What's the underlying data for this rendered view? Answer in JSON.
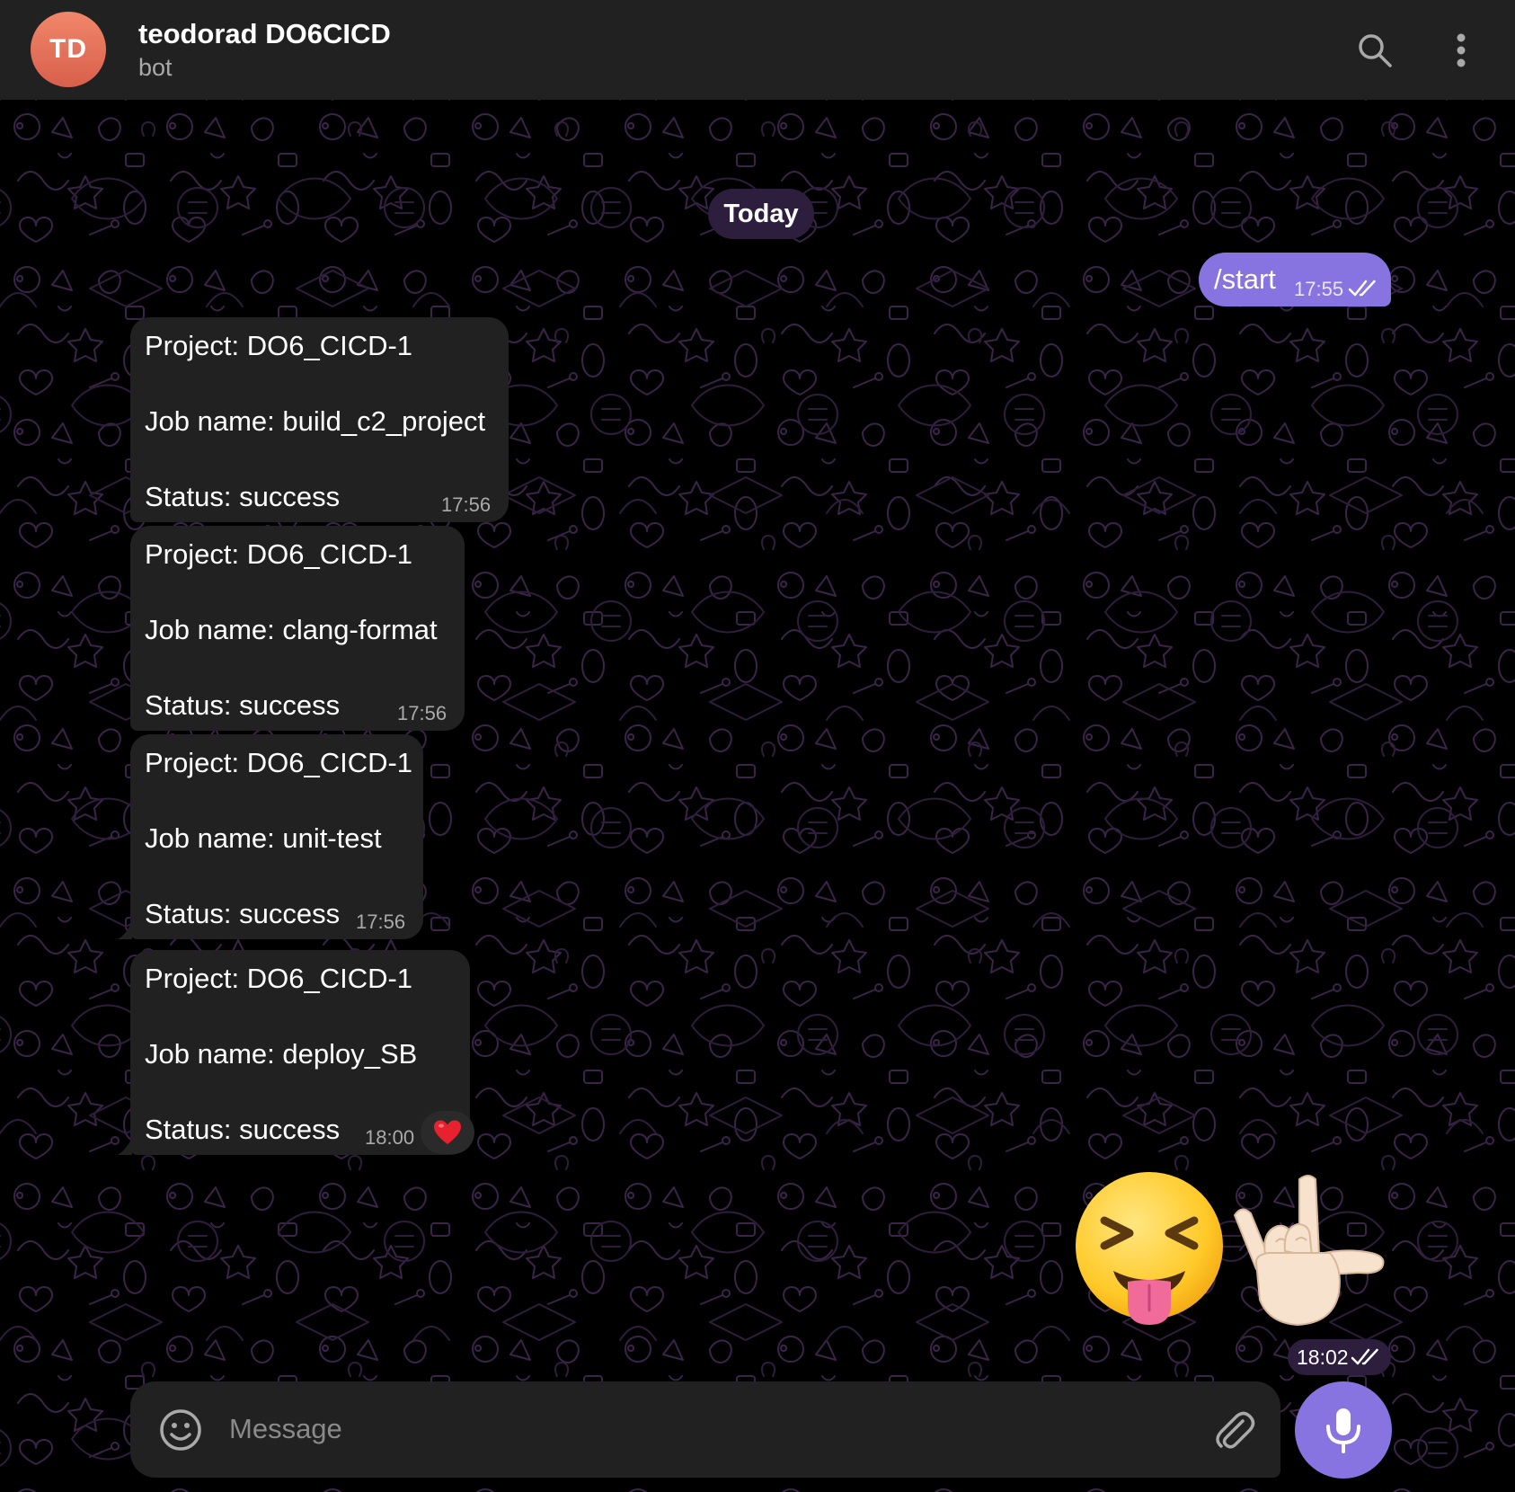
{
  "header": {
    "avatar_initials": "TD",
    "title": "teodorad DO6CICD",
    "subtitle": "bot",
    "icons": [
      "search-icon",
      "more-vertical-icon"
    ]
  },
  "date_separator": "Today",
  "outgoing": {
    "text": "/start",
    "time": "17:55",
    "status": "read"
  },
  "messages": [
    {
      "project": "Project: DO6_CICD-1",
      "job": "Job name: build_c2_project",
      "status": "Status: success",
      "time": "17:56"
    },
    {
      "project": "Project: DO6_CICD-1",
      "job": "Job name: clang-format",
      "status": "Status: success",
      "time": "17:56"
    },
    {
      "project": "Project: DO6_CICD-1",
      "job": "Job name: unit-test",
      "status": "Status: success",
      "time": "17:56"
    },
    {
      "project": "Project: DO6_CICD-1",
      "job": "Job name: deploy_SB",
      "status": "Status: success",
      "time": "18:00",
      "reaction": "heart"
    }
  ],
  "stickers": {
    "items": [
      "squinting-tongue-face",
      "love-you-gesture-hand"
    ],
    "time": "18:02",
    "status": "read"
  },
  "composer": {
    "placeholder": "Message",
    "icons": [
      "smile-icon",
      "paperclip-icon",
      "microphone-icon"
    ]
  },
  "colors": {
    "accent": "#8774e1",
    "header_bg": "#212121",
    "bubble_bg": "#212121",
    "date_pill_bg": "#2d1e3e",
    "avatar": "#e0715a"
  }
}
